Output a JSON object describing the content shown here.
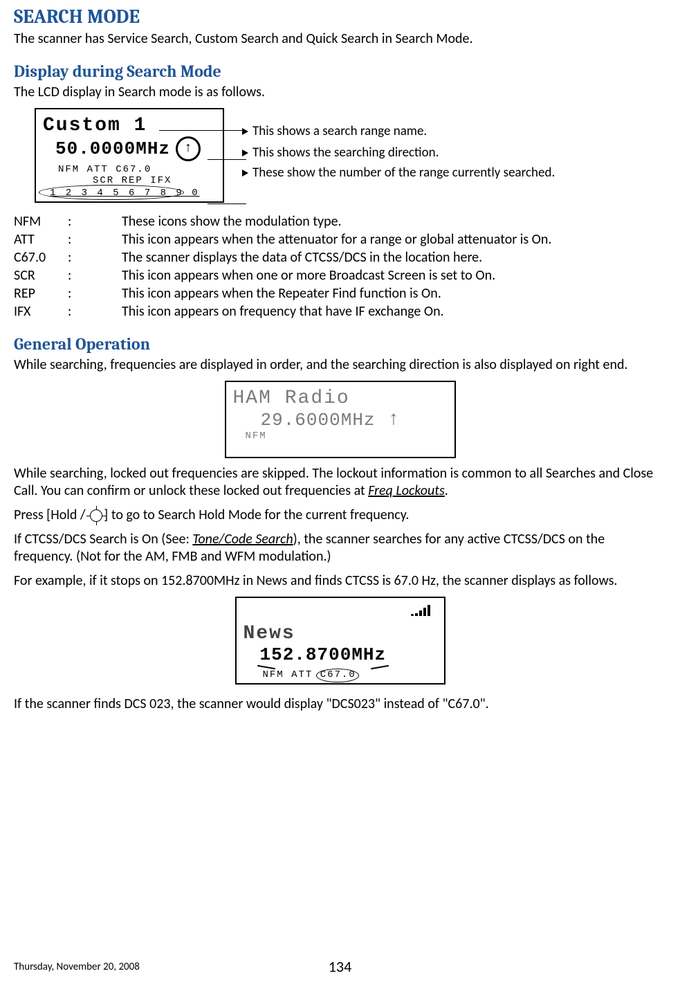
{
  "headings": {
    "search_mode": "SEARCH MODE",
    "display_during": "Display during Search Mode",
    "general_operation": "General Operation"
  },
  "intro": {
    "search_mode_desc": "The scanner has Service Search, Custom Search and Quick Search in Search Mode.",
    "display_desc": "The LCD display in Search mode is as follows."
  },
  "lcd1": {
    "line1": "Custom 1",
    "freq": "50.0000MHz",
    "arrow": "↑",
    "icons": "NFM  ATT   C67.0",
    "icons2": "SCR REP IFX",
    "ranges": "1 2 3 4 5 6 7 8 9 0"
  },
  "annotations": {
    "a1": "This shows a search range name.",
    "a2": "This shows the searching direction.",
    "a3": "These show the number of the range currently searched."
  },
  "defs": [
    {
      "k": "NFM",
      "v": "These icons show the modulation type."
    },
    {
      "k": "ATT",
      "v": "This icon appears when the attenuator for a range or global attenuator is On."
    },
    {
      "k": "C67.0",
      "v": "The scanner displays the data of CTCSS/DCS in the location here."
    },
    {
      "k": "SCR",
      "v": "This icon appears when one or more Broadcast Screen is set to On."
    },
    {
      "k": "REP",
      "v": "This icon appears when the Repeater Find function is On."
    },
    {
      "k": "IFX",
      "v": "This icon appears on frequency that have IF exchange On."
    }
  ],
  "general_op": {
    "p1": "While searching, frequencies are displayed in order, and the searching direction is also displayed on right end.",
    "p2a": "While searching, locked out frequencies are skipped. The lockout information is common to all Searches and Close Call. You can confirm or unlock these locked out frequencies at ",
    "p2_link": "Freq Lockouts",
    "p2b": ".",
    "p3a": "Press [Hold / ",
    "p3b": "] to go to Search Hold Mode for the current frequency.",
    "p4a": "If CTCSS/DCS Search is On (See: ",
    "p4_link": "Tone/Code Search",
    "p4b": "), the scanner searches for any active CTCSS/DCS on the frequency. (Not for the AM, FMB and WFM modulation.)",
    "p5": "For example, if it stops on 152.8700MHz in News and finds CTCSS is 67.0 Hz, the scanner displays as follows.",
    "p6": "If the scanner finds DCS 023, the scanner would display \"DCS023\" instead of \"C67.0\"."
  },
  "lcd2": {
    "line1": "HAM Radio",
    "freq": "29.6000MHz",
    "arrow": "↑",
    "mod": "NFM"
  },
  "lcd3": {
    "line1": "News",
    "freq": "152.8700MHz",
    "icons": "NFM  ATT  ",
    "ctcss": "C67.0"
  },
  "footer": {
    "date": "Thursday, November 20, 2008",
    "page": "134"
  }
}
